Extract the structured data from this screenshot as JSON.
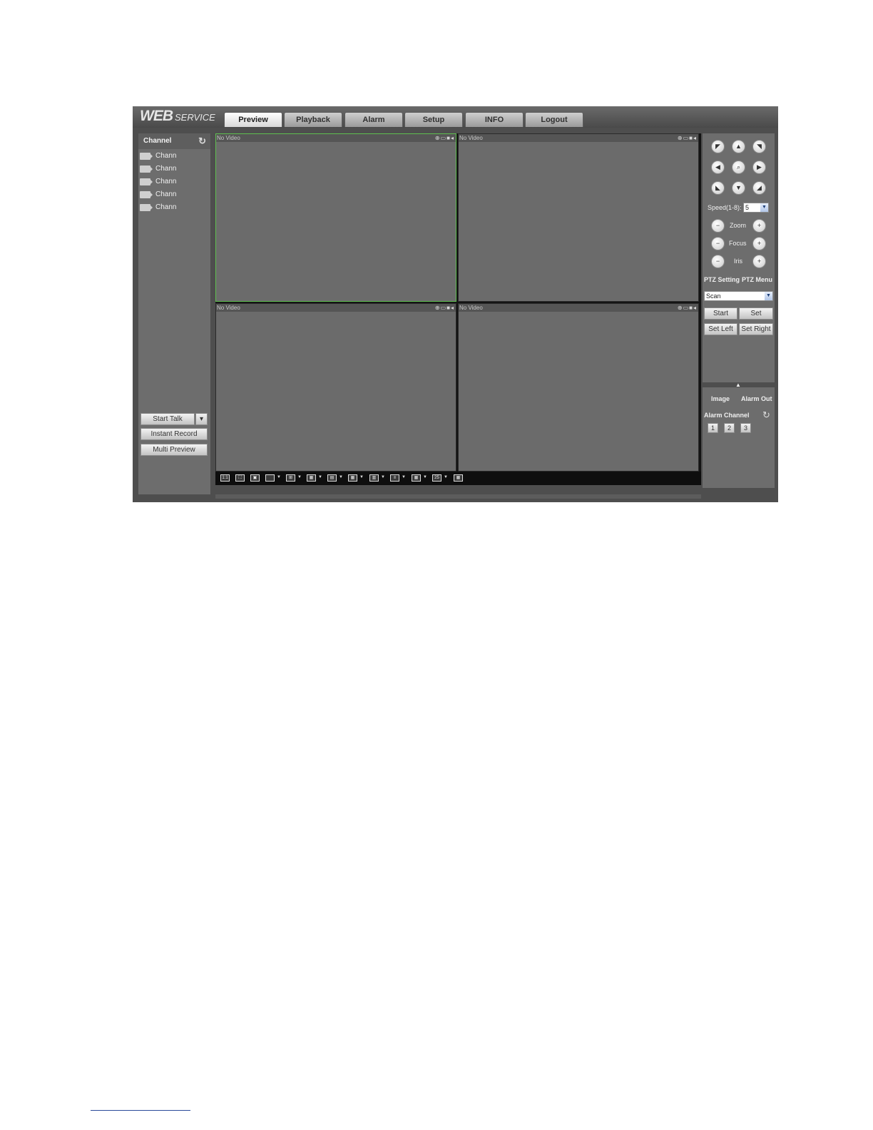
{
  "logo": {
    "word": "WEB",
    "sub": "SERVICE"
  },
  "tabs": [
    {
      "label": "Preview",
      "active": true
    },
    {
      "label": "Playback",
      "active": false
    },
    {
      "label": "Alarm",
      "active": false
    },
    {
      "label": "Setup",
      "active": false
    },
    {
      "label": "INFO",
      "active": false
    },
    {
      "label": "Logout",
      "active": false
    }
  ],
  "sidebar": {
    "header": "Channel",
    "refresh_icon": "refresh-icon",
    "channels": [
      {
        "label": "Chann",
        "icon": "camera-icon"
      },
      {
        "label": "Chann",
        "icon": "camera-icon"
      },
      {
        "label": "Chann",
        "icon": "camera-icon"
      },
      {
        "label": "Chann",
        "icon": "camera-icon"
      },
      {
        "label": "Chann",
        "icon": "camera-icon"
      }
    ],
    "start_talk": "Start Talk",
    "instant_record": "Instant Record",
    "multi_preview": "Multi Preview"
  },
  "video": {
    "panes": [
      {
        "status": "No Video",
        "active": true
      },
      {
        "status": "No Video",
        "active": false
      },
      {
        "status": "No Video",
        "active": false
      },
      {
        "status": "No Video",
        "active": false
      }
    ],
    "pane_tools": [
      "zoom-icon",
      "snapshot-icon",
      "record-icon",
      "audio-icon"
    ]
  },
  "layout_bar": {
    "buttons": [
      {
        "icon": "original-size-icon",
        "label": "1:1",
        "arrow": false
      },
      {
        "icon": "full-screen-icon",
        "label": "",
        "arrow": false
      },
      {
        "icon": "fit-window-icon",
        "label": "",
        "arrow": false
      },
      {
        "icon": "layout-1-icon",
        "label": "",
        "arrow": true
      },
      {
        "icon": "layout-4-icon",
        "label": "",
        "arrow": true
      },
      {
        "icon": "layout-6-icon",
        "label": "",
        "arrow": true
      },
      {
        "icon": "layout-8-icon",
        "label": "",
        "arrow": true
      },
      {
        "icon": "layout-9-icon",
        "label": "",
        "arrow": true
      },
      {
        "icon": "layout-13-icon",
        "label": "",
        "arrow": true
      },
      {
        "icon": "layout-16-icon",
        "label": "",
        "arrow": true
      },
      {
        "icon": "layout-20-icon",
        "label": "",
        "arrow": true
      },
      {
        "icon": "layout-25-icon",
        "label": "25",
        "arrow": true
      },
      {
        "icon": "layout-36-icon",
        "label": "",
        "arrow": false
      }
    ]
  },
  "ptz": {
    "directions": [
      {
        "icon": "arrow-up-left-icon",
        "glyph": "◤"
      },
      {
        "icon": "arrow-up-icon",
        "glyph": "▲"
      },
      {
        "icon": "arrow-up-right-icon",
        "glyph": "◥"
      },
      {
        "icon": "arrow-left-icon",
        "glyph": "◀"
      },
      {
        "icon": "ptz-center-icon",
        "glyph": "⌕"
      },
      {
        "icon": "arrow-right-icon",
        "glyph": "▶"
      },
      {
        "icon": "arrow-down-left-icon",
        "glyph": "◣"
      },
      {
        "icon": "arrow-down-icon",
        "glyph": "▼"
      },
      {
        "icon": "arrow-down-right-icon",
        "glyph": "◢"
      }
    ],
    "speed_label": "Speed(1-8):",
    "speed_value": "5",
    "controls": [
      {
        "label": "Zoom"
      },
      {
        "label": "Focus"
      },
      {
        "label": "Iris"
      }
    ],
    "tab_setting": "PTZ Setting",
    "tab_menu": "PTZ Menu",
    "mode_value": "Scan",
    "start": "Start",
    "set": "Set",
    "set_left": "Set Left",
    "set_right": "Set Right"
  },
  "bottom_panel": {
    "tab_image": "Image",
    "tab_alarm_out": "Alarm Out",
    "alarm_channel_label": "Alarm Channel",
    "alarm_buttons": [
      "1",
      "2",
      "3"
    ]
  },
  "colors": {
    "active_pane_border": "#5fbf4f",
    "background": "#4e4e4e"
  }
}
